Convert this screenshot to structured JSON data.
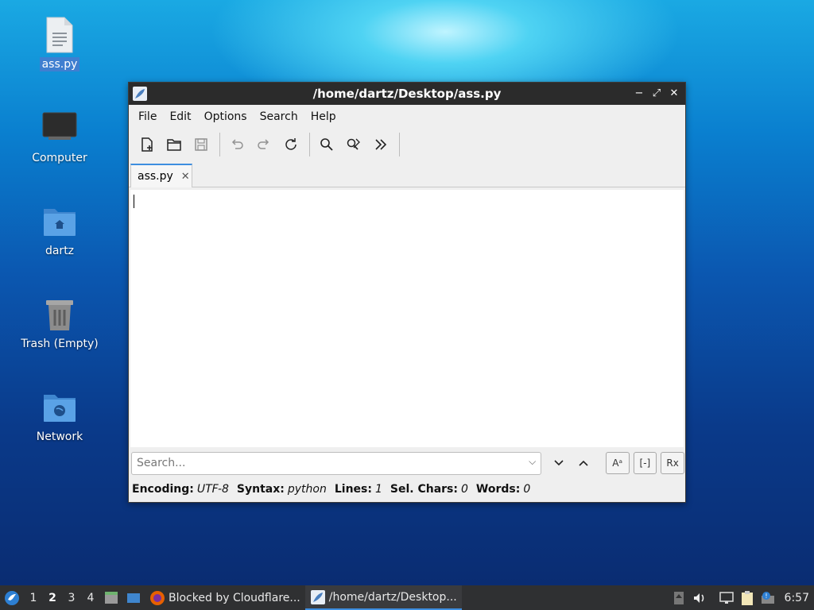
{
  "desktop": {
    "icons": [
      {
        "label": "ass.py"
      },
      {
        "label": "Computer"
      },
      {
        "label": "dartz"
      },
      {
        "label": "Trash (Empty)"
      },
      {
        "label": "Network"
      }
    ]
  },
  "window": {
    "title": "/home/dartz/Desktop/ass.py",
    "controls": {
      "minimize": "−",
      "maximize": "⤢",
      "close": "✕"
    },
    "menu": [
      "File",
      "Edit",
      "Options",
      "Search",
      "Help"
    ],
    "toolbar": [
      "new-file-icon",
      "open-file-icon",
      "save-file-icon",
      "undo-icon",
      "redo-icon",
      "reload-icon",
      "find-icon",
      "find-replace-icon",
      "more-icon"
    ],
    "tab": {
      "label": "ass.py",
      "close": "✕"
    },
    "search": {
      "placeholder": "Search...",
      "case_label": "Aᵃ",
      "whole_label": "[-]",
      "regex_label": "Rx"
    },
    "status": {
      "encoding_key": "Encoding:",
      "encoding_val": "UTF-8",
      "syntax_key": "Syntax:",
      "syntax_val": "python",
      "lines_key": "Lines:",
      "lines_val": "1",
      "sel_key": "Sel. Chars:",
      "sel_val": "0",
      "words_key": "Words:",
      "words_val": "0"
    }
  },
  "taskbar": {
    "workspaces": [
      "1",
      "2",
      "3",
      "4"
    ],
    "active_workspace": "2",
    "apps": [
      {
        "label": "Blocked by Cloudflare..."
      },
      {
        "label": "/home/dartz/Desktop..."
      }
    ],
    "clock": "6:57"
  },
  "colors": {
    "accent": "#3d8ee0",
    "titlebar": "#2b2b2b",
    "taskbar": "#2f3032"
  }
}
